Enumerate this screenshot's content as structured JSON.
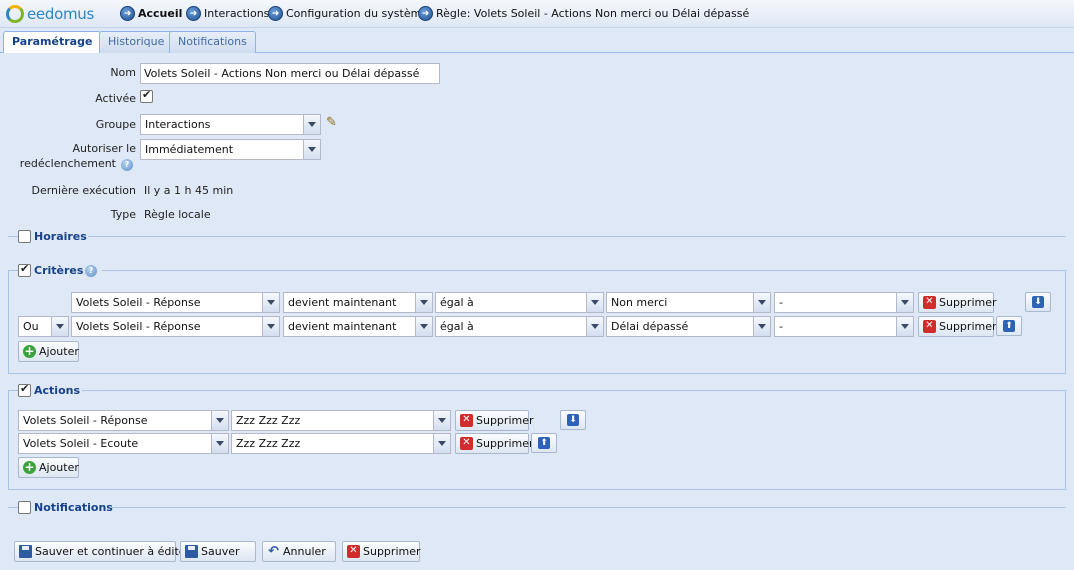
{
  "brand": {
    "logo_text": "eedomus"
  },
  "breadcrumb": [
    {
      "label": "Accueil"
    },
    {
      "label": "Interactions"
    },
    {
      "label": "Configuration du système"
    },
    {
      "label": "Règle: Volets Soleil - Actions Non merci ou Délai dépassé"
    }
  ],
  "tabs": [
    {
      "label": "Paramétrage"
    },
    {
      "label": "Historique"
    },
    {
      "label": "Notifications"
    }
  ],
  "form": {
    "nom_label": "Nom",
    "nom_value": "Volets Soleil - Actions Non merci ou Délai dépassé",
    "activee_label": "Activée",
    "activee_checked": true,
    "groupe_label": "Groupe",
    "groupe_value": "Interactions",
    "autoriser_label_1": "Autoriser le",
    "autoriser_label_2": "redéclenchement",
    "autoriser_value": "Immédiatement",
    "derniere_label": "Dernière exécution",
    "derniere_value": "Il y a 1 h 45 min",
    "type_label": "Type",
    "type_value": "Règle locale"
  },
  "sections": {
    "horaires": {
      "label": "Horaires",
      "checked": false
    },
    "criteres": {
      "label": "Critères",
      "checked": true
    },
    "actions": {
      "label": "Actions",
      "checked": true
    },
    "notifications": {
      "label": "Notifications",
      "checked": false
    }
  },
  "criteres_rows": [
    {
      "op": "",
      "device": "Volets Soleil - Réponse",
      "when": "devient maintenant",
      "cmp": "égal à",
      "value": "Non merci",
      "extra": "-",
      "delete_label": "Supprimer"
    },
    {
      "op": "Ou",
      "device": "Volets Soleil - Réponse",
      "when": "devient maintenant",
      "cmp": "égal à",
      "value": "Délai dépassé",
      "extra": "-",
      "delete_label": "Supprimer"
    }
  ],
  "actions_rows": [
    {
      "device": "Volets Soleil - Réponse",
      "value": "Zzz Zzz Zzz",
      "delete_label": "Supprimer"
    },
    {
      "device": "Volets Soleil - Ecoute",
      "value": "Zzz Zzz Zzz",
      "delete_label": "Supprimer"
    }
  ],
  "add_label": "Ajouter",
  "footer": {
    "save_continue": "Sauver et continuer à éditer",
    "save": "Sauver",
    "cancel": "Annuler",
    "delete": "Supprimer"
  }
}
